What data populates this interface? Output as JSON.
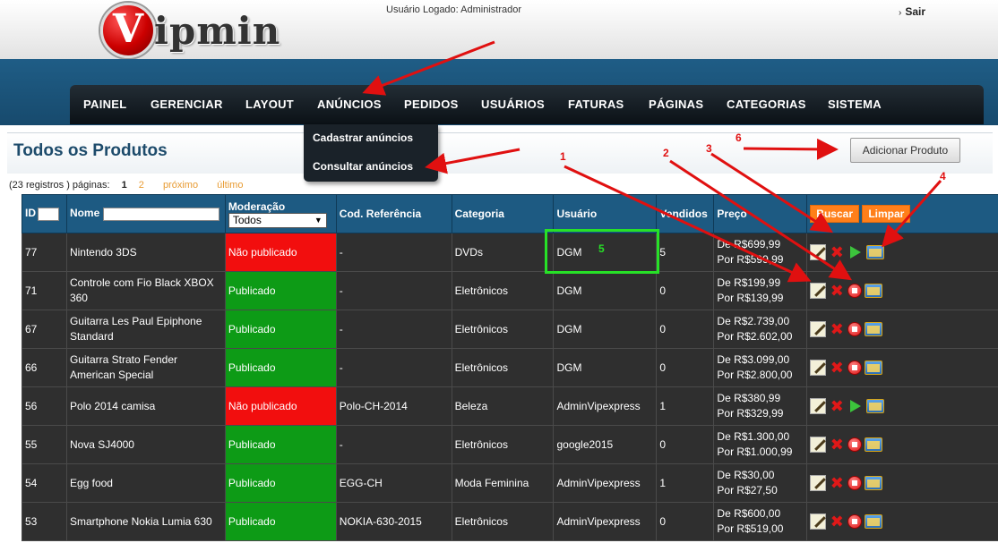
{
  "header": {
    "logo_letter": "V",
    "logo_text": "ipmin",
    "logged_user": "Usuário Logado: Administrador",
    "logout_label": "Sair"
  },
  "nav": {
    "items": [
      "PAINEL",
      "GERENCIAR",
      "LAYOUT",
      "ANÚNCIOS",
      "PEDIDOS",
      "USUÁRIOS",
      "FATURAS",
      "PÁGINAS",
      "CATEGORIAS",
      "SISTEMA"
    ],
    "dropdown": [
      "Cadastrar anúncios",
      "Consultar anúncios"
    ]
  },
  "page": {
    "title": "Todos os Produtos",
    "add_button": "Adicionar Produto"
  },
  "pager": {
    "summary": "(23 registros ) páginas:",
    "current": "1",
    "page2": "2",
    "next": "próximo",
    "last": "último"
  },
  "table": {
    "headers": {
      "id": "ID",
      "name": "Nome",
      "moderation": "Moderação",
      "moderation_select": "Todos",
      "reference": "Cod. Referência",
      "category": "Categoria",
      "user": "Usuário",
      "sold": "Vendidos",
      "price": "Preço",
      "search_button": "Buscar",
      "clear_button": "Limpar"
    },
    "rows": [
      {
        "id": "77",
        "name": "Nintendo 3DS",
        "moderation": "Não publicado",
        "published": false,
        "ref": "-",
        "category": "DVDs",
        "user": "DGM",
        "sold": "5",
        "price_from": "De R$699,99",
        "price_to": "Por R$599,99"
      },
      {
        "id": "71",
        "name": "Controle com Fio Black XBOX 360",
        "moderation": "Publicado",
        "published": true,
        "ref": "-",
        "category": "Eletrônicos",
        "user": "DGM",
        "sold": "0",
        "price_from": "De R$199,99",
        "price_to": "Por R$139,99"
      },
      {
        "id": "67",
        "name": "Guitarra Les Paul Epiphone Standard",
        "moderation": "Publicado",
        "published": true,
        "ref": "-",
        "category": "Eletrônicos",
        "user": "DGM",
        "sold": "0",
        "price_from": "De R$2.739,00",
        "price_to": "Por R$2.602,00"
      },
      {
        "id": "66",
        "name": "Guitarra Strato Fender American Special",
        "moderation": "Publicado",
        "published": true,
        "ref": "-",
        "category": "Eletrônicos",
        "user": "DGM",
        "sold": "0",
        "price_from": "De R$3.099,00",
        "price_to": "Por R$2.800,00"
      },
      {
        "id": "56",
        "name": "Polo 2014 camisa",
        "moderation": "Não publicado",
        "published": false,
        "ref": "Polo-CH-2014",
        "category": "Beleza",
        "user": "AdminVipexpress",
        "sold": "1",
        "price_from": "De R$380,99",
        "price_to": "Por R$329,99"
      },
      {
        "id": "55",
        "name": "Nova SJ4000",
        "moderation": "Publicado",
        "published": true,
        "ref": "-",
        "category": "Eletrônicos",
        "user": "google2015",
        "sold": "0",
        "price_from": "De R$1.300,00",
        "price_to": "Por R$1.000,99"
      },
      {
        "id": "54",
        "name": "Egg food",
        "moderation": "Publicado",
        "published": true,
        "ref": "EGG-CH",
        "category": "Moda Feminina",
        "user": "AdminVipexpress",
        "sold": "1",
        "price_from": "De R$30,00",
        "price_to": "Por R$27,50"
      },
      {
        "id": "53",
        "name": "Smartphone Nokia Lumia 630",
        "moderation": "Publicado",
        "published": true,
        "ref": "NOKIA-630-2015",
        "category": "Eletrônicos",
        "user": "AdminVipexpress",
        "sold": "0",
        "price_from": "De R$600,00",
        "price_to": "Por R$519,00"
      }
    ]
  },
  "annotations": {
    "numbers": [
      "1",
      "2",
      "3",
      "4",
      "5",
      "6"
    ],
    "arrow_color": "#e01010",
    "highlight_color": "#27e127"
  }
}
